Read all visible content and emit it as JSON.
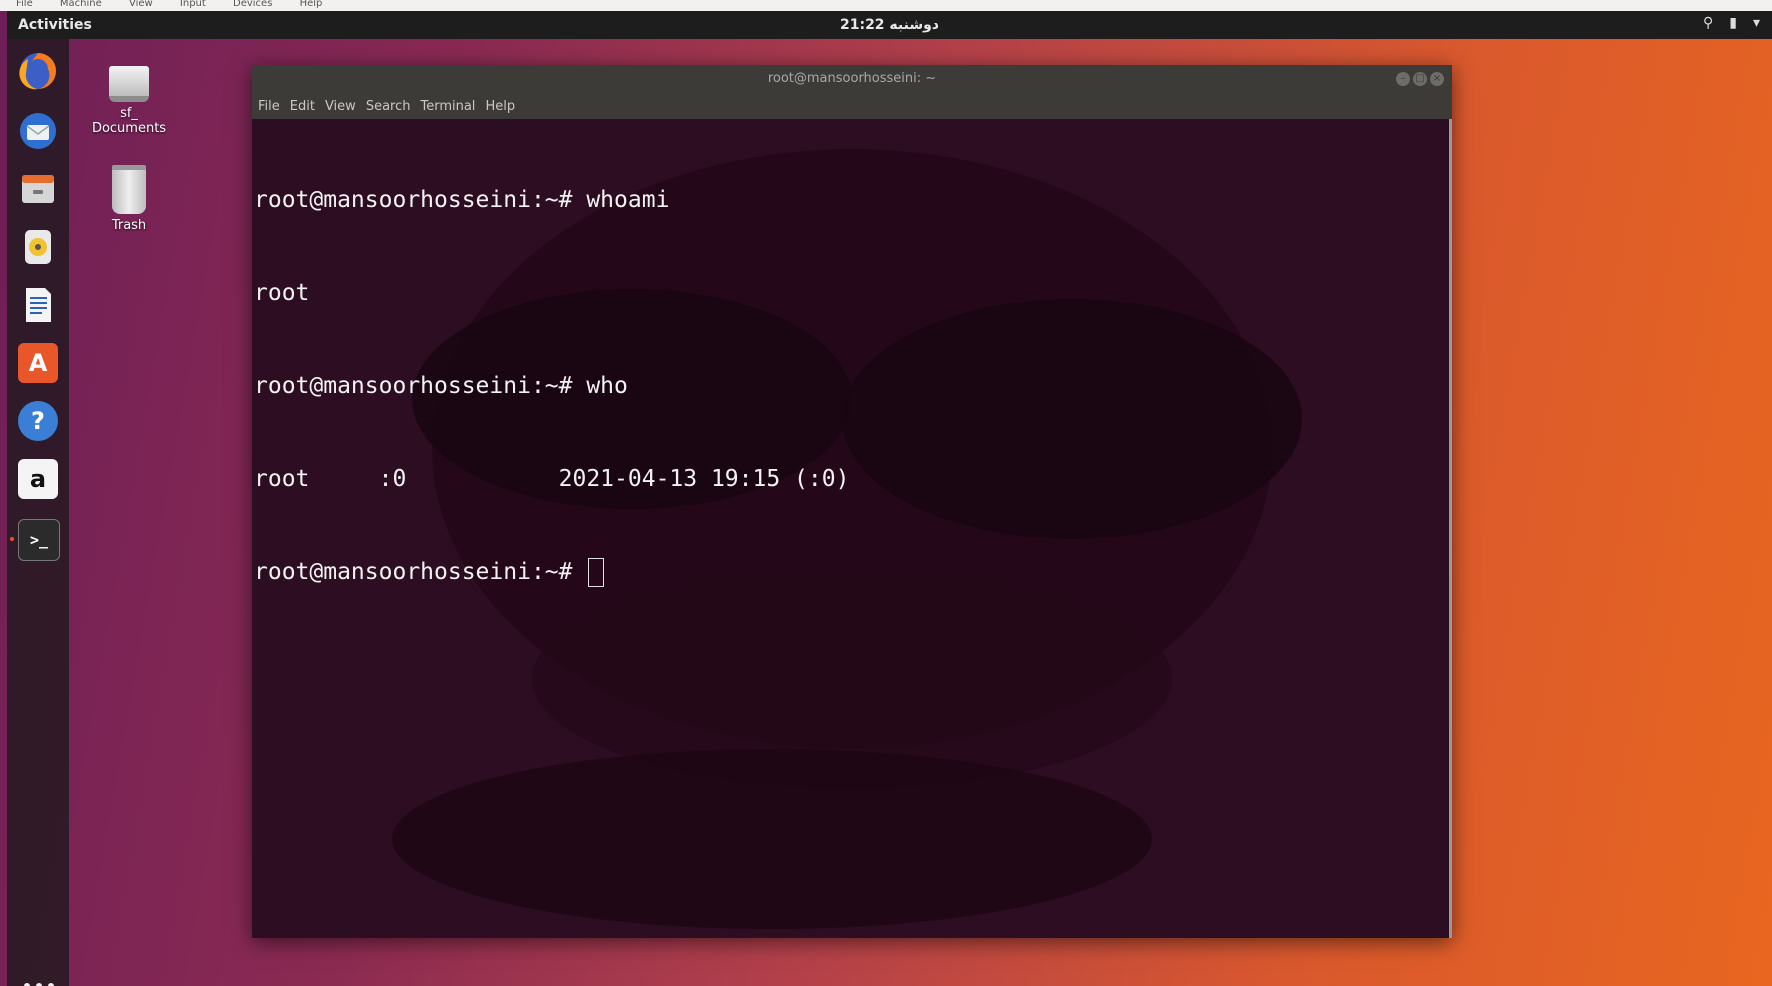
{
  "vm_menu": [
    "File",
    "Machine",
    "View",
    "Input",
    "Devices",
    "Help"
  ],
  "topbar": {
    "activities": "Activities",
    "clock": "21:22 دوشنبه",
    "tray_icons": [
      "accessibility-icon",
      "battery-icon",
      "system-menu-chevron-icon"
    ]
  },
  "dock": {
    "apps": [
      {
        "name": "firefox",
        "icon": "firefox-icon"
      },
      {
        "name": "thunderbird",
        "icon": "thunderbird-icon"
      },
      {
        "name": "files",
        "icon": "files-icon"
      },
      {
        "name": "rhythmbox",
        "icon": "rhythmbox-icon"
      },
      {
        "name": "writer",
        "icon": "libreoffice-writer-icon"
      },
      {
        "name": "software",
        "icon": "ubuntu-software-icon"
      },
      {
        "name": "help",
        "icon": "help-icon"
      },
      {
        "name": "amazon",
        "icon": "amazon-icon"
      },
      {
        "name": "terminal",
        "icon": "terminal-icon"
      }
    ],
    "amazon_glyph": "a",
    "help_glyph": "?",
    "software_glyph": "A",
    "terminal_glyph": ">_"
  },
  "desktop": {
    "drive_label": "sf_\nDocuments",
    "trash_label": "Trash"
  },
  "terminal": {
    "title": "root@mansoorhosseini: ~",
    "menu": [
      "File",
      "Edit",
      "View",
      "Search",
      "Terminal",
      "Help"
    ],
    "lines": [
      "root@mansoorhosseini:~# whoami",
      "root",
      "root@mansoorhosseini:~# who",
      "root     :0           2021-04-13 19:15 (:0)",
      "root@mansoorhosseini:~# "
    ]
  }
}
